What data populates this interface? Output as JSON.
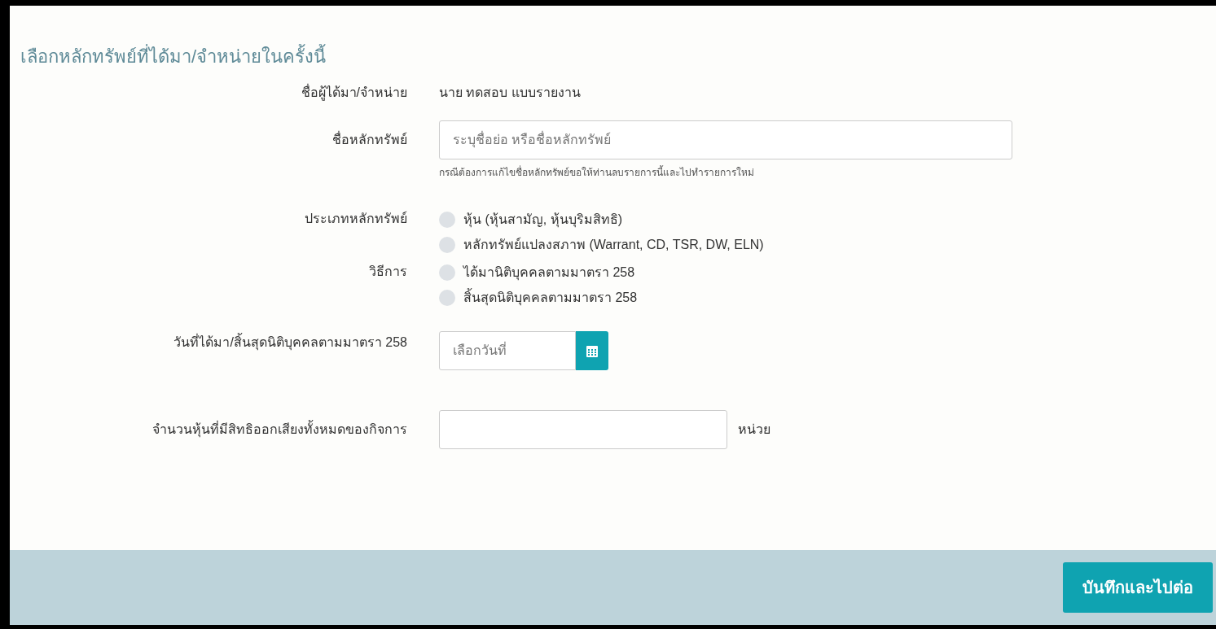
{
  "title": "เลือกหลักทรัพย์ที่ได้มา/จำหน่ายในครั้งนี้",
  "acquirer": {
    "label": "ชื่อผู้ได้มา/จำหน่าย",
    "value": "นาย ทดสอบ แบบรายงาน"
  },
  "security_name": {
    "label": "ชื่อหลักทรัพย์",
    "placeholder": "ระบุชื่อย่อ หรือชื่อหลักทรัพย์",
    "hint": "กรณีต้องการแก้ไขชื่อหลักทรัพย์ขอให้ท่านลบรายการนี้และไปทำรายการใหม่"
  },
  "radio_groups": [
    {
      "label": "ประเภทหลักทรัพย์",
      "options": [
        {
          "label": "หุ้น (หุ้นสามัญ, หุ้นบุริมสิทธิ)",
          "selected": false
        },
        {
          "label": "หลักทรัพย์แปลงสภาพ (Warrant, CD, TSR, DW, ELN)",
          "selected": false
        }
      ]
    },
    {
      "label": "วิธีการ",
      "options": [
        {
          "label": "ได้มานิติบุคคลตามมาตรา 258",
          "selected": false
        },
        {
          "label": "สิ้นสุดนิติบุคคลตามมาตรา 258",
          "selected": false
        }
      ]
    }
  ],
  "date": {
    "label": "วันที่ได้มา/สิ้นสุดนิติบุคคลตามมาตรา 258",
    "placeholder": "เลือกวันที่"
  },
  "voting_shares": {
    "label": "จำนวนหุ้นที่มีสิทธิออกเสียงทั้งหมดของกิจการ",
    "unit": "หน่วย"
  },
  "submit_button": "บันทึกและไปต่อ"
}
